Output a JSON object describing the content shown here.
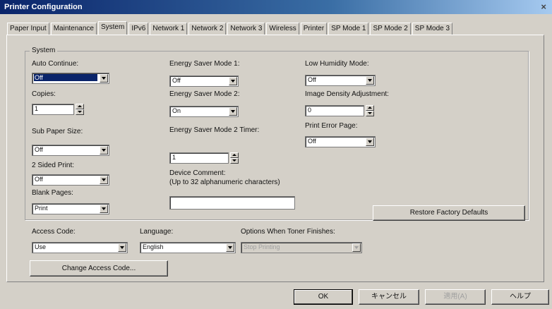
{
  "window": {
    "title": "Printer Configuration",
    "close_glyph": "×"
  },
  "tabs": [
    "Paper Input",
    "Maintenance",
    "System",
    "IPv6",
    "Network 1",
    "Network 2",
    "Network 3",
    "Wireless",
    "Printer",
    "SP Mode 1",
    "SP Mode 2",
    "SP Mode 3"
  ],
  "active_tab": "System",
  "system": {
    "group_label": "System",
    "auto_continue": {
      "label": "Auto Continue:",
      "value": "Off"
    },
    "copies": {
      "label": "Copies:",
      "value": "1"
    },
    "sub_paper_size": {
      "label": "Sub Paper Size:",
      "value": "Off"
    },
    "two_sided_print": {
      "label": "2 Sided Print:",
      "value": "Off"
    },
    "blank_pages": {
      "label": "Blank Pages:",
      "value": "Print"
    },
    "energy_saver_1": {
      "label": "Energy Saver Mode 1:",
      "value": "Off"
    },
    "energy_saver_2": {
      "label": "Energy Saver Mode 2:",
      "value": "On"
    },
    "energy_saver_2_timer": {
      "label": "Energy Saver Mode 2 Timer:",
      "value": "1"
    },
    "device_comment": {
      "label": "Device Comment:",
      "hint": "(Up to 32 alphanumeric characters)",
      "value": ""
    },
    "low_humidity": {
      "label": "Low Humidity Mode:",
      "value": "Off"
    },
    "image_density": {
      "label": "Image Density Adjustment:",
      "value": "0"
    },
    "print_error_page": {
      "label": "Print Error Page:",
      "value": "Off"
    },
    "restore_defaults": "Restore Factory Defaults"
  },
  "access": {
    "access_code": {
      "label": "Access Code:",
      "value": "Use"
    },
    "language": {
      "label": "Language:",
      "value": "English"
    },
    "toner": {
      "label": "Options When Toner Finishes:",
      "value": "Stop Printing"
    },
    "change_button": "Change Access Code..."
  },
  "footer": {
    "ok": "OK",
    "cancel": "キャンセル",
    "apply": "適用(A)",
    "help": "ヘルプ"
  },
  "colors": {
    "title_start": "#0a246a",
    "title_end": "#a6caf0",
    "face": "#d4d0c8"
  }
}
